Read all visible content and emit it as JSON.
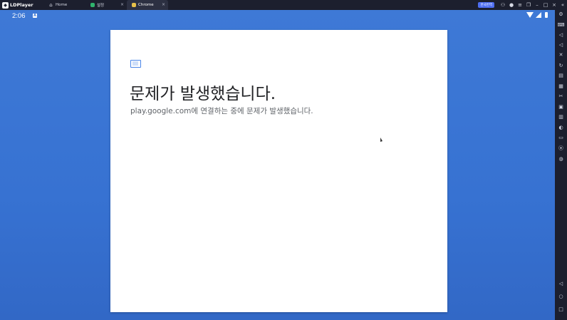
{
  "app": {
    "name": "LDPlayer"
  },
  "tabs": [
    {
      "label": "Home",
      "icon": "home-icon"
    },
    {
      "label": "설정",
      "icon": "settings-app-icon",
      "close": "×"
    },
    {
      "label": "Chrome",
      "icon": "chrome-icon",
      "close": "×"
    }
  ],
  "top_controls": {
    "hk_badge": "한국번역"
  },
  "status_bar": {
    "time": "2:06",
    "keyboard_indicator": "A"
  },
  "error_page": {
    "title": "문제가 발생했습니다.",
    "description": "play.google.com에 연결하는 중에 문제가 발생했습니다."
  },
  "colors": {
    "screen_background": "#3772d2",
    "toolbar_background": "#1c1f2e",
    "accent": "#4e6ef2"
  }
}
